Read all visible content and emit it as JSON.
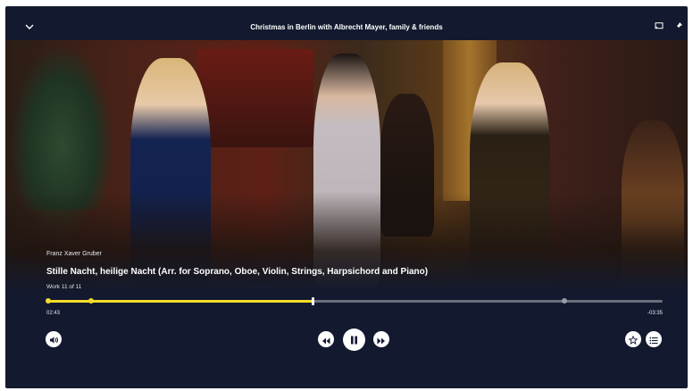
{
  "header": {
    "title": "Christmas in Berlin with Albrecht Mayer, family & friends",
    "collapse_icon": "chevron-down-icon",
    "cast_icon": "cast-icon",
    "pin_icon": "pin-icon"
  },
  "track": {
    "composer": "Franz Xaver Gruber",
    "title": "Stille Nacht, heilige Nacht (Arr. for Soprano, Oboe, Violin, Strings, Harpsichord and Piano)",
    "work_position": "Work 11 of 11"
  },
  "playback": {
    "elapsed": "02:43",
    "remaining": "-03:35",
    "progress_fraction": 0.43,
    "chapter_markers": [
      0.0,
      0.07,
      0.84
    ]
  },
  "controls": {
    "volume_icon": "volume-icon",
    "previous_icon": "previous-icon",
    "pause_icon": "pause-icon",
    "next_icon": "next-icon",
    "favorite_icon": "star-icon",
    "list_icon": "list-icon"
  },
  "colors": {
    "background": "#131a2f",
    "accent": "#f4dc2c",
    "track_bg": "#6a6d7a"
  }
}
